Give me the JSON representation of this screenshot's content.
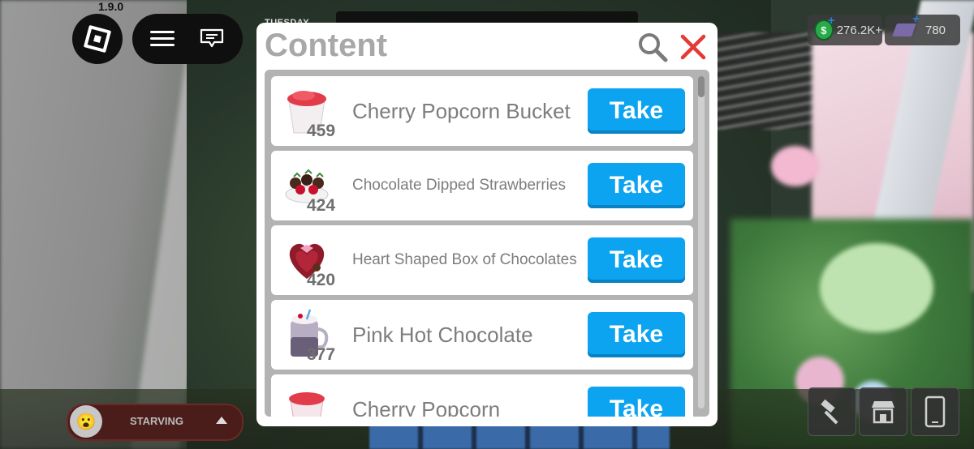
{
  "hud": {
    "version": "1.9.0",
    "day": "TUESDAY"
  },
  "currency": {
    "money": "276.2K+",
    "bucks": "780",
    "money_symbol": "$"
  },
  "mood": {
    "label": "STARVING",
    "face": "😮"
  },
  "modal": {
    "title": "Content",
    "items": [
      {
        "name": "Cherry Popcorn Bucket",
        "qty": "459",
        "action": "Take",
        "icon": "popcorn-bucket-icon"
      },
      {
        "name": "Chocolate Dipped Strawberries",
        "qty": "424",
        "action": "Take",
        "icon": "strawberries-icon"
      },
      {
        "name": "Heart Shaped Box of Chocolates",
        "qty": "420",
        "action": "Take",
        "icon": "heart-box-icon"
      },
      {
        "name": "Pink Hot Chocolate",
        "qty": "377",
        "action": "Take",
        "icon": "hot-chocolate-icon"
      },
      {
        "name": "Cherry Popcorn",
        "qty": "",
        "action": "Take",
        "icon": "cherry-popcorn-icon"
      }
    ]
  },
  "colors": {
    "take_button": "#0ca4f0",
    "close_x": "#e53935",
    "modal_title": "#a8a8a8"
  }
}
